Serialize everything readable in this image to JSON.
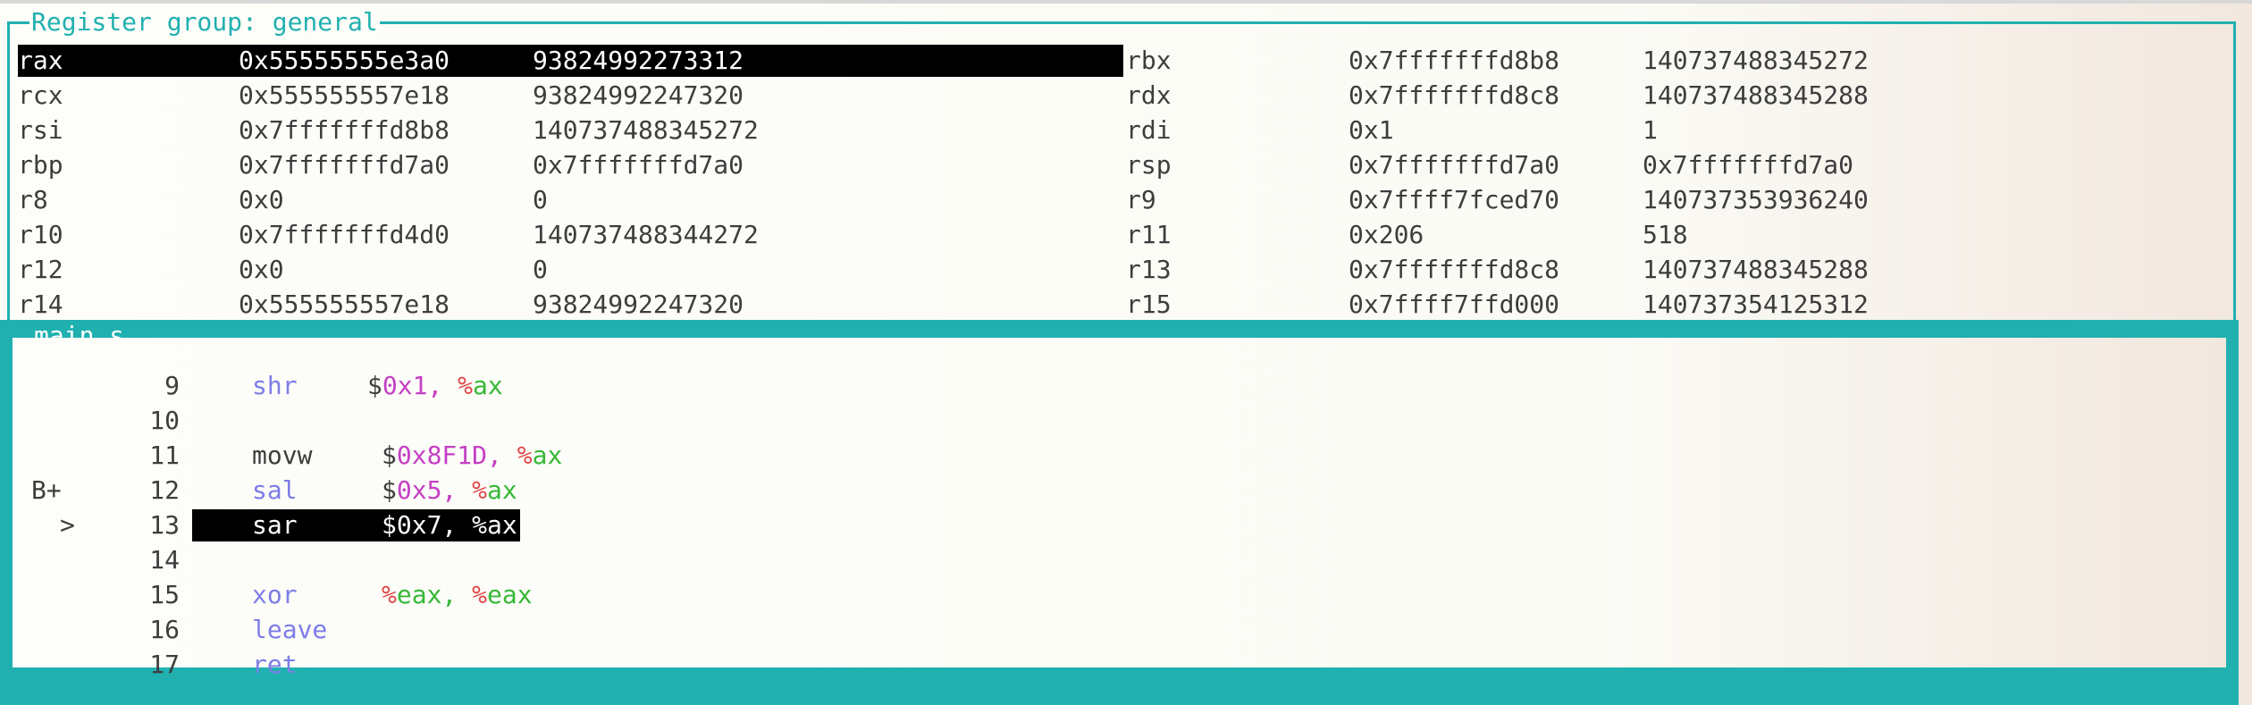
{
  "register_pane": {
    "title": "Register group: general",
    "rows": [
      {
        "n1": "rax",
        "h1": "0x55555555e3a0",
        "v1": "93824992273312",
        "n2": "rbx",
        "h2": "0x7fffffffd8b8",
        "v2": "140737488345272"
      },
      {
        "n1": "rcx",
        "h1": "0x555555557e18",
        "v1": "93824992247320",
        "n2": "rdx",
        "h2": "0x7fffffffd8c8",
        "v2": "140737488345288"
      },
      {
        "n1": "rsi",
        "h1": "0x7fffffffd8b8",
        "v1": "140737488345272",
        "n2": "rdi",
        "h2": "0x1",
        "v2": "1"
      },
      {
        "n1": "rbp",
        "h1": "0x7fffffffd7a0",
        "v1": "0x7fffffffd7a0",
        "n2": "rsp",
        "h2": "0x7fffffffd7a0",
        "v2": "0x7fffffffd7a0"
      },
      {
        "n1": "r8",
        "h1": "0x0",
        "v1": "0",
        "n2": "r9",
        "h2": "0x7ffff7fced70",
        "v2": "140737353936240"
      },
      {
        "n1": "r10",
        "h1": "0x7fffffffd4d0",
        "v1": "140737488344272",
        "n2": "r11",
        "h2": "0x206",
        "v2": "518"
      },
      {
        "n1": "r12",
        "h1": "0x0",
        "v1": "0",
        "n2": "r13",
        "h2": "0x7fffffffd8c8",
        "v2": "140737488345288"
      },
      {
        "n1": "r14",
        "h1": "0x555555557e18",
        "v1": "93824992247320",
        "n2": "r15",
        "h2": "0x7ffff7ffd000",
        "v2": "140737354125312"
      }
    ]
  },
  "source_pane": {
    "title": "main.s",
    "lines": [
      {
        "marker": "",
        "num": "9",
        "instr": "shr",
        "dollar": "$",
        "imm": "0x1,",
        "reg": "%ax"
      },
      {
        "marker": "",
        "num": "10"
      },
      {
        "marker": "",
        "num": "11",
        "instr": "movw",
        "dollar": "$",
        "imm": "0x8F1D,",
        "reg": "%ax"
      },
      {
        "marker": "B+",
        "num": "12",
        "instr": "sal",
        "dollar": "$",
        "imm": "0x5,",
        "reg": "%ax"
      },
      {
        "marker": ">",
        "num": "13",
        "instr": "sar",
        "dollar": "$",
        "imm": "0x7,",
        "reg": "%ax"
      },
      {
        "marker": "",
        "num": "14"
      },
      {
        "marker": "",
        "num": "15",
        "instr": "xor",
        "reg1": "%eax,",
        "reg2": "%eax"
      },
      {
        "marker": "",
        "num": "16",
        "instr": "leave"
      },
      {
        "marker": "",
        "num": "17",
        "instr": "ret"
      }
    ]
  },
  "colors": {
    "border": "#21b0b0",
    "mnemonic": "#7d7de8",
    "immediate": "#c43fc4",
    "register_name": "#38b838",
    "register_percent": "#e04848",
    "highlight": "#000000"
  }
}
